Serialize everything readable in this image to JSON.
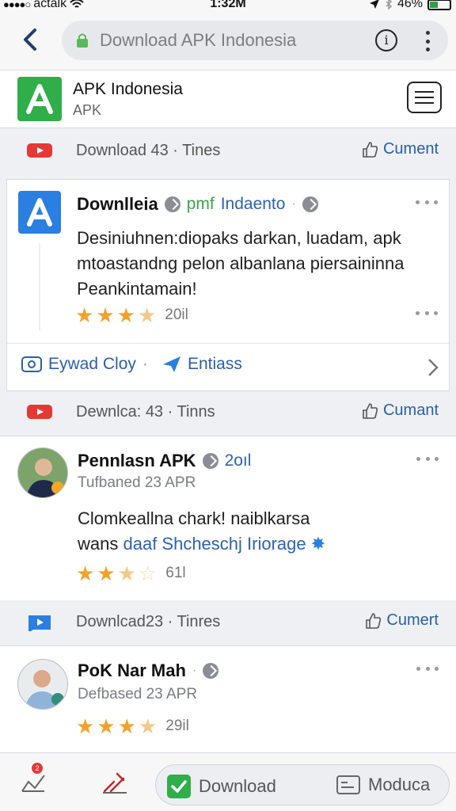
{
  "status_bar": {
    "carrier": "actalk",
    "time": "1:32M",
    "battery": "46%"
  },
  "browser": {
    "url": "Download APK Indonesia",
    "info_symbol": "i"
  },
  "site": {
    "name": "APK Indonesia",
    "subtitle": "APK",
    "logo_letter": "A"
  },
  "sections": [
    {
      "label": "Download 43 · Tines",
      "cta": "Cument"
    },
    {
      "label": "Dewnlca: 43 · Tinns",
      "cta": "Cumant"
    },
    {
      "label": "Downlcad23 · Tinres",
      "cta": "Cumert"
    }
  ],
  "posts": [
    {
      "title": "Downlleia",
      "meta_green": "pmf",
      "meta_blue": "Indaento",
      "desc_lines": [
        "Desiniuhnen:diopaks darkan, luadam, apk",
        "mtoastandng pelon albanlana piersaininna",
        "Peankintamain!"
      ],
      "stars": 3.5,
      "rating_label": "20il",
      "actions": {
        "left": "Eywad Cloy",
        "right": "Entiass"
      }
    },
    {
      "title": "Pennlasn APK",
      "meta_blue": "2oıl",
      "subline": "Tufbaned 23 APR",
      "desc_line1": "Clomkeallna chark! naiblkarsa",
      "desc_line2_plain": "wans ",
      "desc_line2_link": "daaf Shcheschj Iriorage",
      "stars": 2.5,
      "rating_label": "61l"
    },
    {
      "title": "PoK Nar Mah",
      "subline": "Defbased 23 APR",
      "stars": 3.5,
      "rating_label": "29il"
    }
  ],
  "bottom_bar": {
    "download_label": "Download",
    "modify_label": "Moduca",
    "notif_count": "2"
  },
  "colors": {
    "brand_green": "#2fae4a",
    "link_blue": "#2a5fa8",
    "star": "#f2a22b"
  },
  "icons": [
    "back-chevron-icon",
    "lock-icon",
    "info-icon",
    "more-vertical-icon",
    "menu-icon",
    "youtube-icon",
    "thumbs-up-icon",
    "app-store-icon",
    "send-icon",
    "chevron-right-icon",
    "check-icon",
    "card-icon"
  ]
}
